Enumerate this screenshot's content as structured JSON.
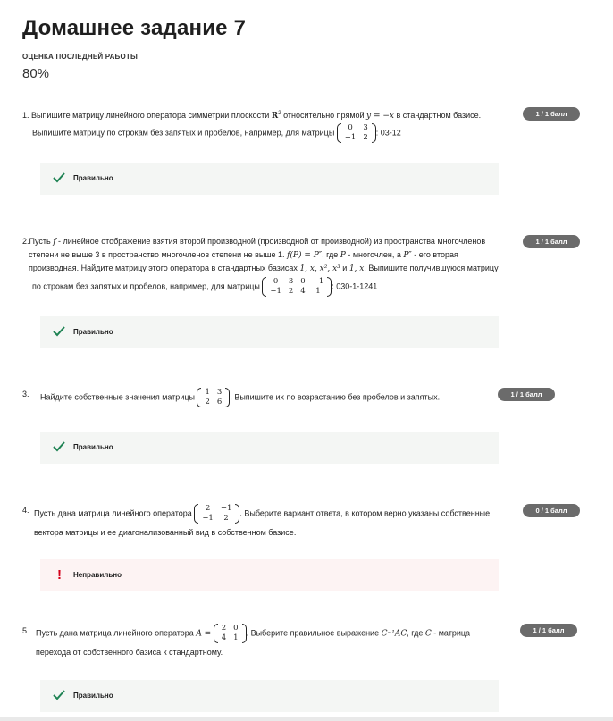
{
  "page": {
    "title": "Домашнее задание 7",
    "grade_label": "ОЦЕНКА ПОСЛЕДНЕЙ РАБОТЫ",
    "grade_value": "80%"
  },
  "questions": [
    {
      "badge": "1 / 1 балл",
      "feedback": "Правильно",
      "line1a": "1.  Выпишите матрицу линейного оператора симметрии плоскости ",
      "line1b": "R",
      "line1b_sup": "2",
      "line1c": " относительно прямой ",
      "line1d": "y = −x",
      "line1e": " в стандартном базисе.",
      "line2a": "Выпишите матрицу  по строкам  без запятых и пробелов, например, для матрицы ",
      "matrix": [
        [
          "0",
          "3"
        ],
        [
          "−1",
          "2"
        ]
      ],
      "line2b": ": 03-12"
    },
    {
      "badge": "1 / 1 балл",
      "feedback": "Правильно",
      "line1a": "2.Пусть ",
      "line1b": "f",
      "line1c": " - линейное отображение взятия второй производной (производной от производной) из пространства многочленов",
      "line2a": "степени не выше 3 в пространство многочленов степени не выше 1.  ",
      "line2b": "f(P) = P″",
      "line2c": ", где ",
      "line2d": "P",
      "line2e": " - многочлен, а ",
      "line2f": "P″",
      "line2g": " - его вторая",
      "line3a": "производная. Найдите матрицу этого оператора в стандартных базисах ",
      "line3b": "1, x, x², x³",
      "line3c": " и ",
      "line3d": "1, x",
      "line3e": ". Выпишите получившуюся матрицу",
      "line4a": "по строкам  без запятых и пробелов, например, для матрицы ",
      "matrix": [
        [
          "0",
          "3",
          "0",
          "−1"
        ],
        [
          "−1",
          "2",
          "4",
          "1"
        ]
      ],
      "line4b": ": 030-1-1241"
    },
    {
      "badge": "1 / 1 балл",
      "feedback": "Правильно",
      "num": "3.",
      "line1a": "Найдите собственные значения матрицы ",
      "matrix": [
        [
          "1",
          "3"
        ],
        [
          "2",
          "6"
        ]
      ],
      "line1b": ". Выпишите их по возрастанию без пробелов и запятых."
    },
    {
      "badge": "0 / 1 балл",
      "feedback": "Неправильно",
      "num": "4.",
      "line1a": "Пусть дана матрица линейного оператора ",
      "matrix": [
        [
          "2",
          "−1"
        ],
        [
          "−1",
          "2"
        ]
      ],
      "line1b": ". Выберите вариант ответа, в котором верно указаны собственные",
      "line2a": "вектора матрицы и ее диагонализованный вид в собственном базисе."
    },
    {
      "badge": "1 / 1 балл",
      "feedback": "Правильно",
      "num": "5.",
      "line1a": "Пусть дана матрица линейного оператора ",
      "line1m": "A =",
      "matrix": [
        [
          "2",
          "0"
        ],
        [
          "4",
          "1"
        ]
      ],
      "line1b": ". Выберите правильное выражение ",
      "line1c": "C⁻¹AC",
      "line1d": ", где ",
      "line1e": "C",
      "line1f": " - матрица",
      "line2a": "перехода от собственного базиса к стандартному."
    }
  ],
  "colors": {
    "badge_bg": "#6b6b6b",
    "correct_bg": "#f4f6f4",
    "wrong_bg": "#fdf3f3",
    "check_green": "#1f8354",
    "error_red": "#d4001a"
  }
}
